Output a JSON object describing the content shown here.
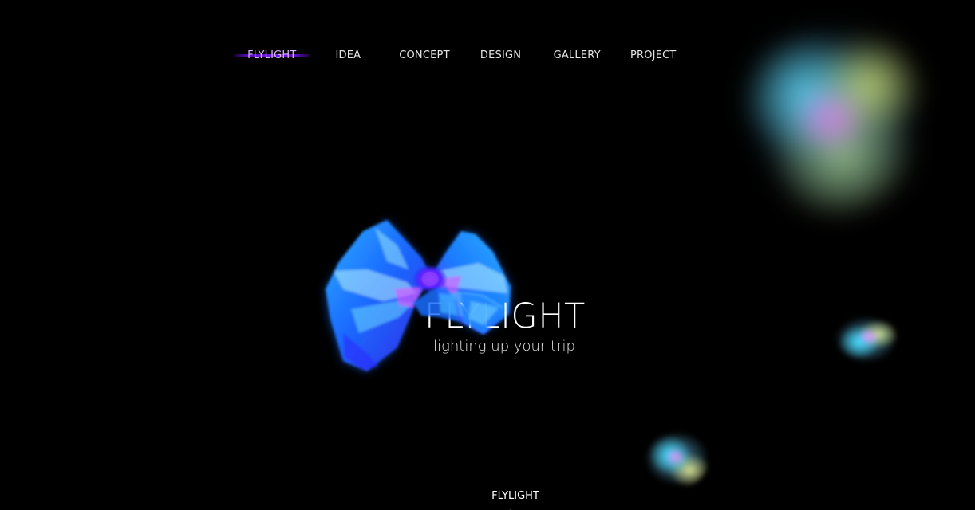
{
  "nav": {
    "items": [
      {
        "label": "FLYLIGHT",
        "active": true
      },
      {
        "label": "IDEA",
        "active": false
      },
      {
        "label": "CONCEPT",
        "active": false
      },
      {
        "label": "DESIGN",
        "active": false
      },
      {
        "label": "GALLERY",
        "active": false
      },
      {
        "label": "PROJECT",
        "active": false
      }
    ],
    "active_color": "#d9b3ff",
    "indicator_color": "#6c1ee0"
  },
  "hero": {
    "title": "FLYLIGHT",
    "tagline": "lighting up your trip"
  },
  "footer": {
    "label": "FLYLIGHT",
    "scroll_icon": "chevron-down-icon"
  },
  "colors": {
    "background": "#000000",
    "text": "#ffffff",
    "glow_blue": "#1e8fff",
    "glow_purple": "#9b3cff"
  }
}
